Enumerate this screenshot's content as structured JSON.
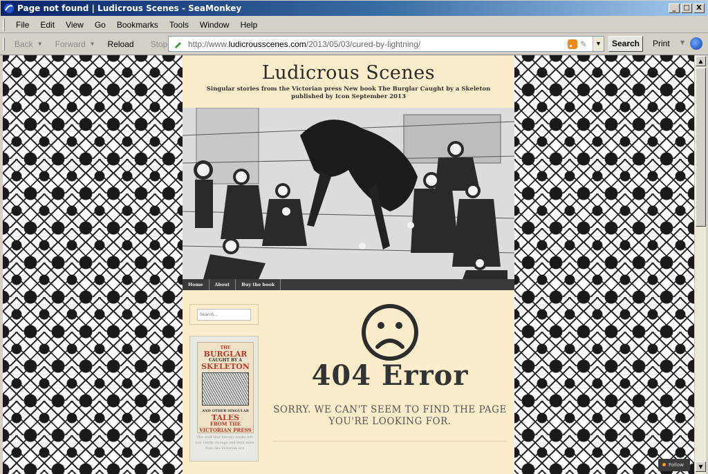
{
  "window": {
    "title": "Page not found | Ludicrous Scenes - SeaMonkey",
    "minimize": "_",
    "maximize": "□",
    "close": "X"
  },
  "menu": [
    "File",
    "Edit",
    "View",
    "Go",
    "Bookmarks",
    "Tools",
    "Window",
    "Help"
  ],
  "nav": {
    "back": "Back",
    "forward": "Forward",
    "reload": "Reload",
    "stop": "Stop",
    "url_prefix": "http://www.",
    "url_domain": "ludicrousscenes.com",
    "url_path": "/2013/05/03/cured-by-lightning/",
    "search": "Search",
    "print": "Print"
  },
  "blog": {
    "title": "Ludicrous Scenes",
    "description": "Singular stories from the Victorian press New book The Burglar Caught by a Skeleton published by Icon September 2013",
    "nav_links": [
      "Home",
      "About",
      "Buy the book"
    ],
    "search_placeholder": "Search...",
    "book": {
      "cover_lines": [
        "THE",
        "BURGLAR",
        "CAUGHT BY A",
        "SKELETON",
        "AND OTHER SINGULAR",
        "TALES",
        "FROM THE",
        "VICTORIAN PRESS"
      ],
      "caption": "The stuff that literary books left out: Oddly strange and dark tales from the Victorian era"
    },
    "error": {
      "face": "☹",
      "title": "404 Error",
      "message": "SORRY. WE CAN'T SEEM TO FIND THE PAGE YOU'RE LOOKING FOR."
    },
    "follow": "Follow"
  },
  "colors": {
    "page_bg": "#fbeccb",
    "titlebar_start": "#0a246a",
    "nav_strip": "#3a3a3a"
  }
}
